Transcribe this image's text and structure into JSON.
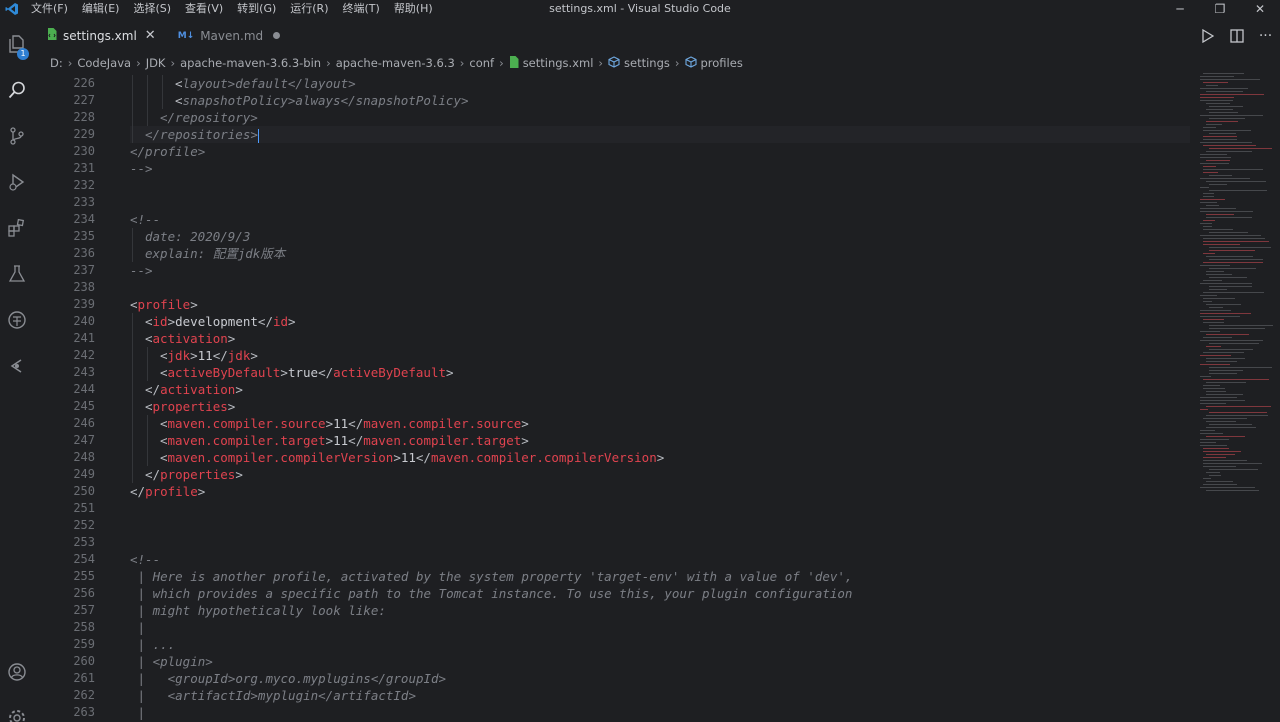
{
  "window": {
    "title": "settings.xml - Visual Studio Code",
    "menu": [
      "文件(F)",
      "编辑(E)",
      "选择(S)",
      "查看(V)",
      "转到(G)",
      "运行(R)",
      "终端(T)",
      "帮助(H)"
    ]
  },
  "activity": {
    "explorer_badge": "1"
  },
  "tabs": [
    {
      "label": "settings.xml",
      "active": true
    },
    {
      "label": "Maven.md",
      "active": false
    }
  ],
  "breadcrumb": [
    "D:",
    "CodeJava",
    "JDK",
    "apache-maven-3.6.3-bin",
    "apache-maven-3.6.3",
    "conf",
    "settings.xml",
    "settings",
    "profiles"
  ],
  "editor": {
    "lines": [
      {
        "n": "226",
        "ind": 3,
        "segs": [
          [
            "br",
            "<"
          ],
          [
            "cm",
            "layout>default</layout>"
          ]
        ]
      },
      {
        "n": "227",
        "ind": 3,
        "segs": [
          [
            "br",
            "<"
          ],
          [
            "cm",
            "snapshotPolicy>always</snapshotPolicy>"
          ]
        ]
      },
      {
        "n": "228",
        "ind": 2,
        "segs": [
          [
            "cm",
            "</repository>"
          ]
        ]
      },
      {
        "n": "229",
        "ind": 1,
        "segs": [
          [
            "cm",
            "</repositories>"
          ]
        ],
        "cur": true
      },
      {
        "n": "230",
        "ind": 0,
        "segs": [
          [
            "cm",
            "</profile>"
          ]
        ]
      },
      {
        "n": "231",
        "ind": 0,
        "segs": [
          [
            "cm",
            "-->"
          ]
        ]
      },
      {
        "n": "232",
        "ind": 0,
        "segs": []
      },
      {
        "n": "233",
        "ind": 0,
        "segs": []
      },
      {
        "n": "234",
        "ind": 0,
        "segs": [
          [
            "cm",
            "<!--"
          ]
        ]
      },
      {
        "n": "235",
        "ind": 1,
        "segs": [
          [
            "cm",
            "date: 2020/9/3"
          ]
        ]
      },
      {
        "n": "236",
        "ind": 1,
        "segs": [
          [
            "cm",
            "explain: 配置jdk版本"
          ]
        ]
      },
      {
        "n": "237",
        "ind": 0,
        "segs": [
          [
            "cm",
            "-->"
          ]
        ]
      },
      {
        "n": "238",
        "ind": 0,
        "segs": []
      },
      {
        "n": "239",
        "ind": 0,
        "segs": [
          [
            "br",
            "<"
          ],
          [
            "tg",
            "profile"
          ],
          [
            "br",
            ">"
          ]
        ]
      },
      {
        "n": "240",
        "ind": 1,
        "segs": [
          [
            "br",
            "<"
          ],
          [
            "tg",
            "id"
          ],
          [
            "br",
            ">"
          ],
          [
            "tx",
            "development"
          ],
          [
            "br",
            "</"
          ],
          [
            "tg",
            "id"
          ],
          [
            "br",
            ">"
          ]
        ]
      },
      {
        "n": "241",
        "ind": 1,
        "segs": [
          [
            "br",
            "<"
          ],
          [
            "tg",
            "activation"
          ],
          [
            "br",
            ">"
          ]
        ]
      },
      {
        "n": "242",
        "ind": 2,
        "segs": [
          [
            "br",
            "<"
          ],
          [
            "tg",
            "jdk"
          ],
          [
            "br",
            ">"
          ],
          [
            "tx",
            "11"
          ],
          [
            "br",
            "</"
          ],
          [
            "tg",
            "jdk"
          ],
          [
            "br",
            ">"
          ]
        ]
      },
      {
        "n": "243",
        "ind": 2,
        "segs": [
          [
            "br",
            "<"
          ],
          [
            "tg",
            "activeByDefault"
          ],
          [
            "br",
            ">"
          ],
          [
            "tx",
            "true"
          ],
          [
            "br",
            "</"
          ],
          [
            "tg",
            "activeByDefault"
          ],
          [
            "br",
            ">"
          ]
        ]
      },
      {
        "n": "244",
        "ind": 1,
        "segs": [
          [
            "br",
            "</"
          ],
          [
            "tg",
            "activation"
          ],
          [
            "br",
            ">"
          ]
        ]
      },
      {
        "n": "245",
        "ind": 1,
        "segs": [
          [
            "br",
            "<"
          ],
          [
            "tg",
            "properties"
          ],
          [
            "br",
            ">"
          ]
        ]
      },
      {
        "n": "246",
        "ind": 2,
        "segs": [
          [
            "br",
            "<"
          ],
          [
            "tg",
            "maven.compiler.source"
          ],
          [
            "br",
            ">"
          ],
          [
            "tx",
            "11"
          ],
          [
            "br",
            "</"
          ],
          [
            "tg",
            "maven.compiler.source"
          ],
          [
            "br",
            ">"
          ]
        ]
      },
      {
        "n": "247",
        "ind": 2,
        "segs": [
          [
            "br",
            "<"
          ],
          [
            "tg",
            "maven.compiler.target"
          ],
          [
            "br",
            ">"
          ],
          [
            "tx",
            "11"
          ],
          [
            "br",
            "</"
          ],
          [
            "tg",
            "maven.compiler.target"
          ],
          [
            "br",
            ">"
          ]
        ]
      },
      {
        "n": "248",
        "ind": 2,
        "segs": [
          [
            "br",
            "<"
          ],
          [
            "tg",
            "maven.compiler.compilerVersion"
          ],
          [
            "br",
            ">"
          ],
          [
            "tx",
            "11"
          ],
          [
            "br",
            "</"
          ],
          [
            "tg",
            "maven.compiler.compilerVersion"
          ],
          [
            "br",
            ">"
          ]
        ]
      },
      {
        "n": "249",
        "ind": 1,
        "segs": [
          [
            "br",
            "</"
          ],
          [
            "tg",
            "properties"
          ],
          [
            "br",
            ">"
          ]
        ]
      },
      {
        "n": "250",
        "ind": 0,
        "segs": [
          [
            "br",
            "</"
          ],
          [
            "tg",
            "profile"
          ],
          [
            "br",
            ">"
          ]
        ]
      },
      {
        "n": "251",
        "ind": 0,
        "segs": []
      },
      {
        "n": "252",
        "ind": 0,
        "segs": []
      },
      {
        "n": "253",
        "ind": 0,
        "segs": []
      },
      {
        "n": "254",
        "ind": 0,
        "segs": [
          [
            "cm",
            "<!--"
          ]
        ]
      },
      {
        "n": "255",
        "ind": 0,
        "segs": [
          [
            "cm",
            " | Here is another profile, activated by the system property 'target-env' with a value of 'dev',"
          ]
        ]
      },
      {
        "n": "256",
        "ind": 0,
        "segs": [
          [
            "cm",
            " | which provides a specific path to the Tomcat instance. To use this, your plugin configuration"
          ]
        ]
      },
      {
        "n": "257",
        "ind": 0,
        "segs": [
          [
            "cm",
            " | might hypothetically look like:"
          ]
        ]
      },
      {
        "n": "258",
        "ind": 0,
        "segs": [
          [
            "cm",
            " |"
          ]
        ]
      },
      {
        "n": "259",
        "ind": 0,
        "segs": [
          [
            "cm",
            " | ..."
          ]
        ]
      },
      {
        "n": "260",
        "ind": 0,
        "segs": [
          [
            "cm",
            " | <plugin>"
          ]
        ]
      },
      {
        "n": "261",
        "ind": 0,
        "segs": [
          [
            "cm",
            " |   <groupId>org.myco.myplugins</groupId>"
          ]
        ]
      },
      {
        "n": "262",
        "ind": 0,
        "segs": [
          [
            "cm",
            " |   <artifactId>myplugin</artifactId>"
          ]
        ]
      },
      {
        "n": "263",
        "ind": 0,
        "segs": [
          [
            "cm",
            " |"
          ]
        ]
      }
    ]
  },
  "colors": {
    "background": "#1e1f22",
    "tag": "#e0434f",
    "comment": "#7c7f86",
    "accent": "#2f7fd2"
  }
}
